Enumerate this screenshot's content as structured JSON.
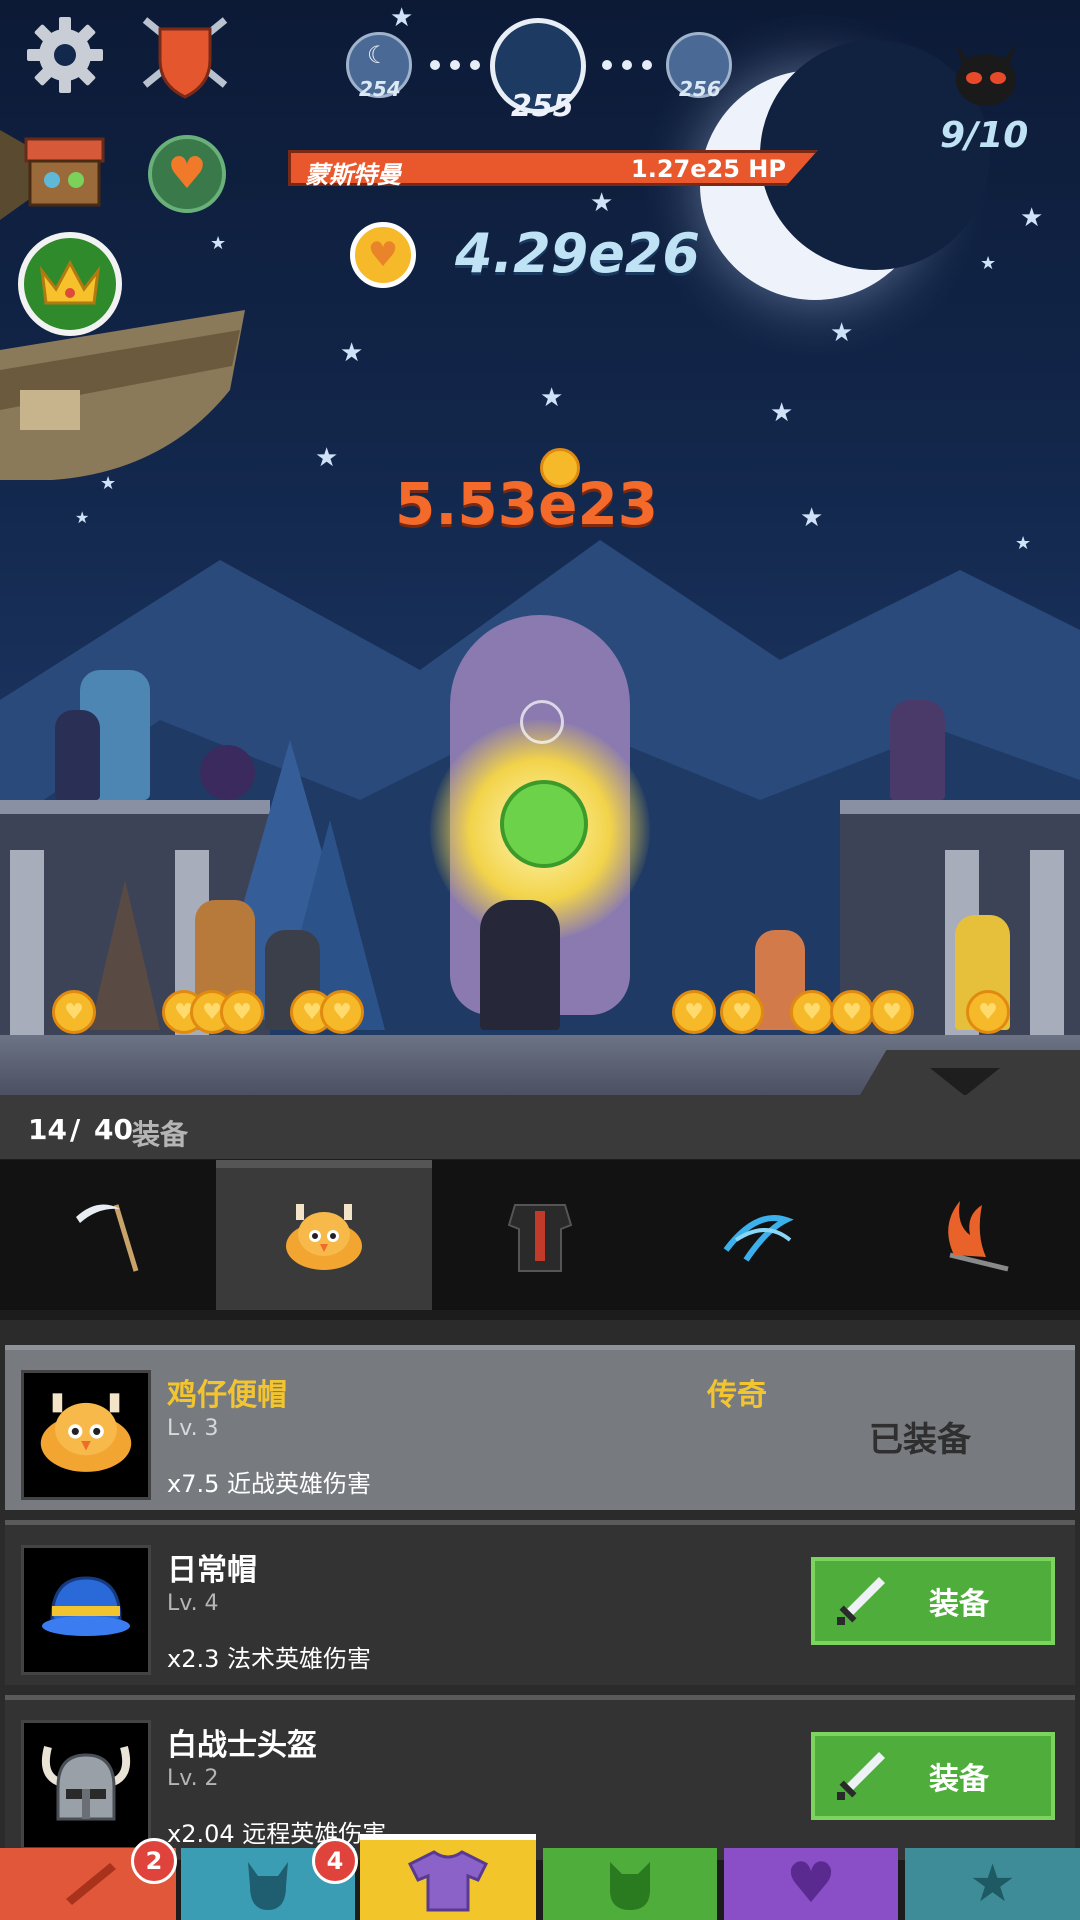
{
  "hud": {
    "stages": {
      "prev": "254",
      "current": "255",
      "next": "256"
    },
    "boss_name": "蒙斯特曼",
    "boss_hp": "1.27e25 HP",
    "gold": "4.29e26",
    "damage_popup": "5.53e23",
    "wave_progress": "9/10",
    "icons": [
      "gear-icon",
      "crest-shield-icon",
      "shop-chest-icon",
      "heart-globe-icon",
      "crown-icon",
      "devil-icon",
      "heart-coin-icon"
    ]
  },
  "equipment": {
    "count": "14",
    "separator": "/",
    "total": "40",
    "label": "装备",
    "tabs": [
      "scythe-icon",
      "chick-hat-icon",
      "armor-icon",
      "blue-wind-icon",
      "fire-sword-icon"
    ],
    "selected_tab": 1,
    "items": [
      {
        "name": "鸡仔便帽",
        "level": "Lv. 3",
        "rarity": "传奇",
        "effect": "x7.5 近战英雄伤害",
        "status": "已装备",
        "equipped": true
      },
      {
        "name": "日常帽",
        "level": "Lv. 4",
        "effect": "x2.3 法术英雄伤害",
        "action": "装备",
        "equipped": false
      },
      {
        "name": "白战士头盔",
        "level": "Lv. 2",
        "effect": "x2.04 远程英雄伤害",
        "action": "装备",
        "equipped": false
      }
    ]
  },
  "bottom_nav": {
    "tabs": [
      {
        "icon": "sword-icon",
        "color": "#e0573a",
        "badge": "2"
      },
      {
        "icon": "hero-icon",
        "color": "#3b9db3",
        "badge": "4"
      },
      {
        "icon": "shirt-icon",
        "color": "#f2c62b",
        "badge": ""
      },
      {
        "icon": "pet-icon",
        "color": "#4fae3b",
        "badge": ""
      },
      {
        "icon": "heart-icon",
        "color": "#8a4fc7",
        "badge": ""
      },
      {
        "icon": "star-icon",
        "color": "#3d8c97",
        "badge": ""
      }
    ]
  },
  "colors": {
    "gold_text": "#f2c530",
    "hp_bar": "#e9572c",
    "equip_green": "#4fae3b"
  }
}
